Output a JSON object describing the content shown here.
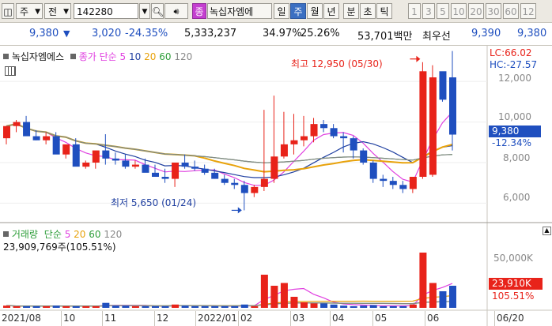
{
  "toolbar": {
    "period_label": "주",
    "market_label": "전",
    "stock_code": "142280",
    "stock_name": "녹십자엠에",
    "tag_label": "종",
    "period_buttons": [
      "일",
      "주",
      "월",
      "년",
      "분",
      "초",
      "틱"
    ],
    "active_period": "주",
    "number_buttons": [
      "1",
      "3",
      "5",
      "10",
      "20",
      "30",
      "60",
      "12"
    ]
  },
  "quote": {
    "price": "9,380",
    "direction_arrow": "▼",
    "change": "3,020",
    "change_pct": "-24.35%",
    "volume": "5,333,237",
    "pct2": "34.97%",
    "pct3": "25.26%",
    "amount": "53,701백만",
    "best_bid_label": "최우선",
    "bid": "9,390",
    "ask": "9,380"
  },
  "price_panel": {
    "legend_name": "녹십자엠에스",
    "legend_type": "종가 단순",
    "ma_periods": [
      "5",
      "10",
      "20",
      "60",
      "120"
    ],
    "high_annotation": "최고 12,950 (05/30)",
    "low_annotation": "최저 5,650 (01/24)",
    "lc": "LC:66.02",
    "hc": "HC:-27.57",
    "y_ticks": [
      "12,000",
      "10,000",
      "8,000",
      "6,000"
    ],
    "current_price_tag": "9,380",
    "current_pct_tag": "-12.34%"
  },
  "volume_panel": {
    "legend_name": "거래량",
    "legend_type": "단순",
    "ma_periods": [
      "5",
      "20",
      "60",
      "120"
    ],
    "current_volume": "23,909,769주(105.51%)",
    "y_ticks": [
      "50,000K"
    ],
    "current_tag": "23,910K",
    "current_pct_tag": "105.51%"
  },
  "x_axis": [
    "2021/08",
    "10",
    "11",
    "12",
    "2022/01",
    "02",
    "03",
    "04",
    "05",
    "06",
    "06/20"
  ],
  "colors": {
    "up": "#e8231a",
    "down": "#1f4fbf",
    "ma5": "#e040e0",
    "ma10": "#1f3fa0",
    "ma20": "#e8a20a",
    "ma60": "#2e9e3a",
    "ma120": "#888888"
  },
  "chart_data": {
    "type": "candlestick",
    "x": [
      "2021-08-02",
      "2021-08-09",
      "2021-08-16",
      "2021-08-23",
      "2021-08-30",
      "2021-09-06",
      "2021-09-13",
      "2021-09-27",
      "2021-10-04",
      "2021-10-11",
      "2021-10-18",
      "2021-10-25",
      "2021-11-01",
      "2021-11-08",
      "2021-11-15",
      "2021-11-22",
      "2021-11-29",
      "2021-12-06",
      "2021-12-13",
      "2021-12-20",
      "2021-12-27",
      "2022-01-03",
      "2022-01-10",
      "2022-01-17",
      "2022-01-24",
      "2022-01-31",
      "2022-02-07",
      "2022-02-14",
      "2022-02-21",
      "2022-02-28",
      "2022-03-07",
      "2022-03-14",
      "2022-03-21",
      "2022-03-28",
      "2022-04-04",
      "2022-04-11",
      "2022-04-18",
      "2022-04-25",
      "2022-05-02",
      "2022-05-09",
      "2022-05-16",
      "2022-05-23",
      "2022-05-30",
      "2022-06-06",
      "2022-06-13",
      "2022-06-20"
    ],
    "series": [
      {
        "open": [
          9200,
          9800,
          10000,
          9300,
          9100,
          9300,
          8400,
          8900,
          7800,
          8000,
          8600,
          8200,
          8100,
          7800,
          7900,
          7500,
          7300,
          7200,
          8000,
          7800,
          7700,
          7500,
          7200,
          7000,
          6900,
          6500,
          6800,
          7200,
          8300,
          8900,
          9100,
          9300,
          9900,
          9700,
          9300,
          9200,
          8600,
          8000,
          7200,
          7100,
          6900,
          6700,
          7300,
          7400,
          12500,
          12200
        ],
        "high": [
          9600,
          10100,
          10300,
          9600,
          9500,
          9500,
          8700,
          9200,
          8100,
          8300,
          9400,
          8500,
          8400,
          8100,
          8200,
          7900,
          7700,
          7700,
          8400,
          8100,
          7900,
          7700,
          7400,
          7200,
          7100,
          6900,
          10600,
          11300,
          10500,
          10400,
          10300,
          10200,
          10100,
          9900,
          9500,
          9300,
          8700,
          8100,
          7400,
          7300,
          7100,
          7000,
          12950,
          12800,
          12400,
          13500
        ],
        "low": [
          8900,
          9500,
          9800,
          9100,
          8900,
          8800,
          8200,
          8700,
          7700,
          7700,
          7900,
          7900,
          7700,
          7700,
          7600,
          7300,
          7000,
          6800,
          7700,
          7600,
          7400,
          7200,
          6900,
          6700,
          5650,
          6300,
          6600,
          7000,
          8200,
          8400,
          8800,
          9000,
          9500,
          9200,
          8500,
          8200,
          7900,
          7000,
          6800,
          6700,
          6500,
          6500,
          7200,
          7300,
          11000,
          8600
        ],
        "close": [
          9800,
          10000,
          9300,
          9100,
          9300,
          8400,
          8900,
          7800,
          8000,
          8600,
          8200,
          8100,
          7800,
          7900,
          7500,
          7300,
          7200,
          8000,
          7800,
          7700,
          7500,
          7200,
          7000,
          6900,
          6500,
          6800,
          7200,
          8300,
          8900,
          9100,
          9300,
          9900,
          9700,
          9300,
          9200,
          8600,
          8000,
          7200,
          7100,
          6900,
          6700,
          7300,
          12500,
          12200,
          11100,
          9380
        ]
      }
    ],
    "volume_pct": [
      4,
      3,
      3,
      3,
      3,
      4,
      3,
      3,
      3,
      3,
      9,
      4,
      4,
      3,
      3,
      3,
      3,
      6,
      4,
      3,
      3,
      3,
      3,
      3,
      6,
      3,
      60,
      40,
      45,
      20,
      10,
      8,
      8,
      6,
      4,
      3,
      4,
      5,
      3,
      3,
      3,
      6,
      100,
      45,
      30,
      40
    ]
  }
}
